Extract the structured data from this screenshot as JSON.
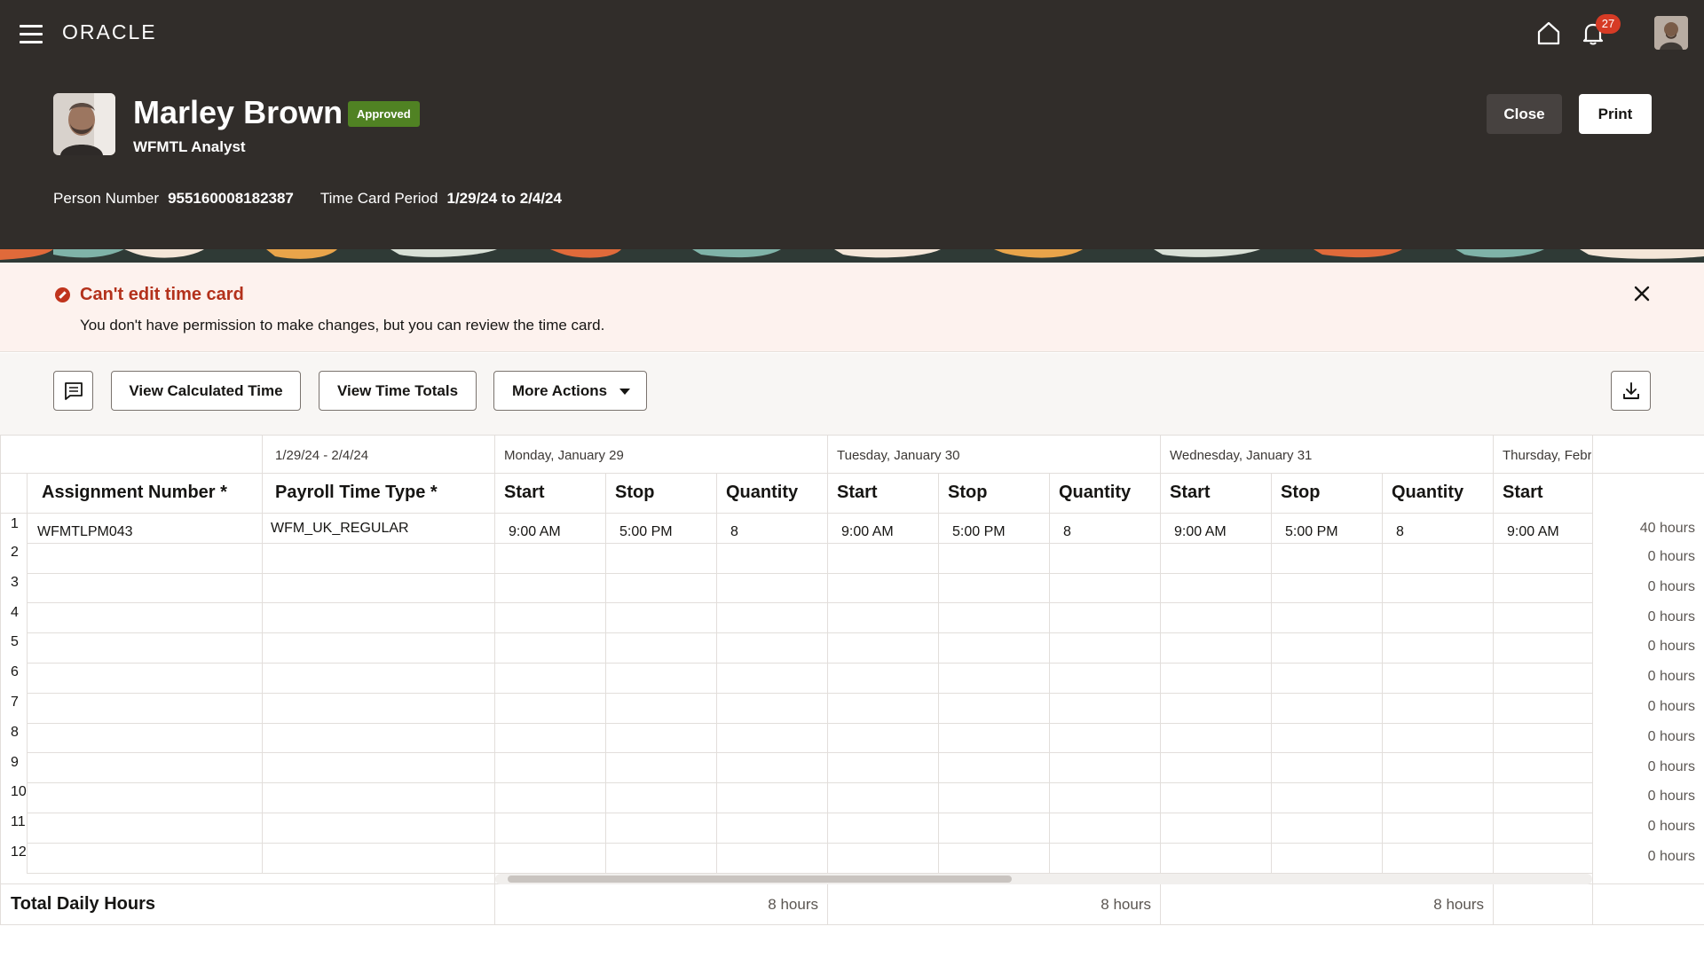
{
  "header": {
    "brand": "ORACLE",
    "notification_count": "27",
    "person_name": "Marley Brown",
    "status": "Approved",
    "job_title": "WFMTL Analyst",
    "close_label": "Close",
    "print_label": "Print",
    "person_number_label": "Person Number",
    "person_number": "955160008182387",
    "period_label": "Time Card Period",
    "period": "1/29/24 to 2/4/24"
  },
  "message": {
    "title": "Can't edit time card",
    "text": "You don't have permission to make changes, but you can review the time card."
  },
  "toolbar": {
    "calc_label": "View Calculated Time",
    "totals_label": "View Time Totals",
    "more_label": "More Actions"
  },
  "grid": {
    "period_header": "1/29/24 - 2/4/24",
    "days": [
      "Monday, January 29",
      "Tuesday, January 30",
      "Wednesday, January 31",
      "Thursday, Febr"
    ],
    "columns": {
      "assignment": "Assignment Number *",
      "payroll": "Payroll Time Type *",
      "start": "Start",
      "stop": "Stop",
      "quantity": "Quantity"
    },
    "row1": {
      "number": "1",
      "assignment": "WFMTLPM043",
      "payroll": "WFM_UK_REGULAR",
      "entries": [
        {
          "start": "9:00 AM",
          "stop": "5:00 PM",
          "quantity": "8"
        },
        {
          "start": "9:00 AM",
          "stop": "5:00 PM",
          "quantity": "8"
        },
        {
          "start": "9:00 AM",
          "stop": "5:00 PM",
          "quantity": "8"
        },
        {
          "start": "9:00 AM"
        }
      ],
      "total": "40 hours"
    },
    "empty_row_numbers": [
      "2",
      "3",
      "4",
      "5",
      "6",
      "7",
      "8",
      "9",
      "10",
      "11",
      "12"
    ],
    "empty_row_total": "0 hours",
    "total_label": "Total Daily Hours",
    "daily_totals": [
      "8 hours",
      "8 hours",
      "8 hours"
    ]
  }
}
